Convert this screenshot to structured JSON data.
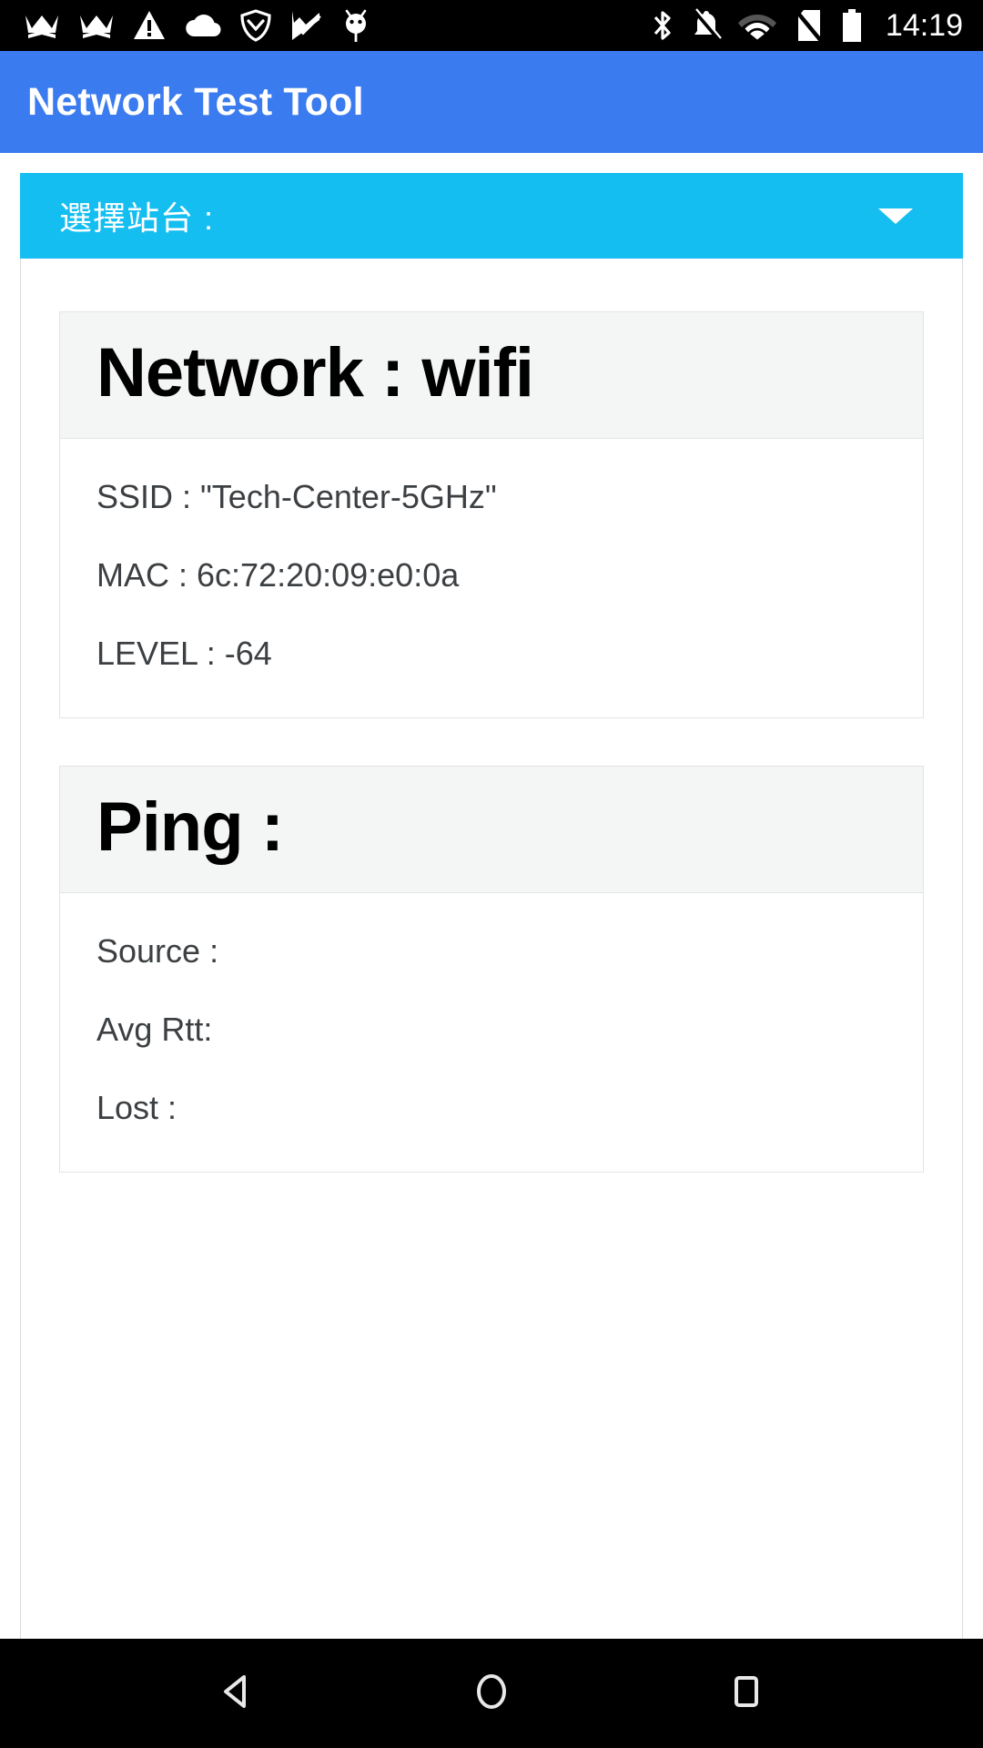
{
  "status_bar": {
    "icons_left": [
      "crown-icon",
      "crown-icon",
      "warning-triangle-icon",
      "cloud-icon",
      "shield-check-icon",
      "checkmark-flag-icon",
      "android-bug-icon"
    ],
    "icons_right": [
      "bluetooth-icon",
      "bell-muted-icon",
      "wifi-icon",
      "no-sim-icon",
      "battery-icon"
    ],
    "clock": "14:19",
    "background_color": "#000000",
    "icon_color": "#ffffff"
  },
  "app_bar": {
    "title": "Network Test Tool",
    "background_color": "#3b7bf0",
    "text_color": "#ffffff"
  },
  "spinner": {
    "label": "選擇站台 :",
    "caret_icon": "chevron-down-icon",
    "background_color": "#14bef0",
    "text_color": "#ffffff"
  },
  "cards": [
    {
      "title": "Network : wifi",
      "lines": [
        "SSID : \"Tech-Center-5GHz\"",
        "MAC : 6c:72:20:09:e0:0a",
        "LEVEL : -64"
      ]
    },
    {
      "title": "Ping :",
      "lines": [
        "Source :",
        "Avg Rtt:",
        "Lost :"
      ]
    }
  ],
  "nav_bar": {
    "back": "back-triangle-icon",
    "home": "home-circle-icon",
    "recents": "recents-square-icon",
    "background_color": "#000000",
    "icon_color": "#e8e8e8"
  }
}
